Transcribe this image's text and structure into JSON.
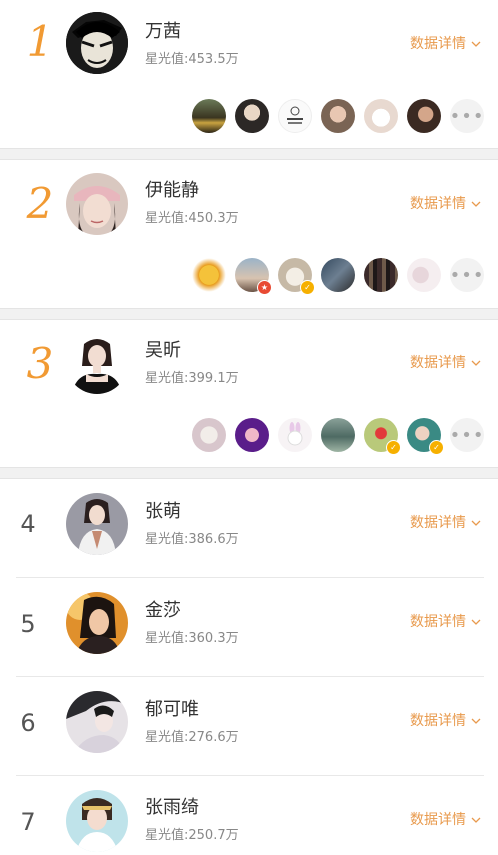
{
  "detail_label": "数据详情",
  "more_glyph": "•••",
  "colors": {
    "accent_orange": "#f19a33",
    "detail_orange": "#e89a4d",
    "rank_plain": "#555555"
  },
  "top": [
    {
      "rank": "1",
      "name": "万茜",
      "score": "星光值:453.5万",
      "fans": [
        {
          "icon": "fan-avatar",
          "badge": ""
        },
        {
          "icon": "fan-avatar",
          "badge": ""
        },
        {
          "icon": "fan-avatar",
          "badge": ""
        },
        {
          "icon": "fan-avatar",
          "badge": ""
        },
        {
          "icon": "fan-avatar",
          "badge": ""
        },
        {
          "icon": "fan-avatar",
          "badge": ""
        }
      ]
    },
    {
      "rank": "2",
      "name": "伊能静",
      "score": "星光值:450.3万",
      "fans": [
        {
          "icon": "fan-avatar",
          "badge": ""
        },
        {
          "icon": "fan-avatar",
          "badge": "red"
        },
        {
          "icon": "fan-avatar",
          "badge": "gold"
        },
        {
          "icon": "fan-avatar",
          "badge": ""
        },
        {
          "icon": "fan-avatar",
          "badge": ""
        },
        {
          "icon": "fan-avatar",
          "badge": ""
        }
      ]
    },
    {
      "rank": "3",
      "name": "吴昕",
      "score": "星光值:399.1万",
      "fans": [
        {
          "icon": "fan-avatar",
          "badge": ""
        },
        {
          "icon": "fan-avatar",
          "badge": ""
        },
        {
          "icon": "fan-avatar",
          "badge": ""
        },
        {
          "icon": "fan-avatar",
          "badge": ""
        },
        {
          "icon": "fan-avatar",
          "badge": "gold"
        },
        {
          "icon": "fan-avatar",
          "badge": "gold"
        }
      ]
    }
  ],
  "rest": [
    {
      "rank": "4",
      "name": "张萌",
      "score": "星光值:386.6万"
    },
    {
      "rank": "5",
      "name": "金莎",
      "score": "星光值:360.3万"
    },
    {
      "rank": "6",
      "name": "郁可唯",
      "score": "星光值:276.6万"
    },
    {
      "rank": "7",
      "name": "张雨绮",
      "score": "星光值:250.7万"
    }
  ]
}
